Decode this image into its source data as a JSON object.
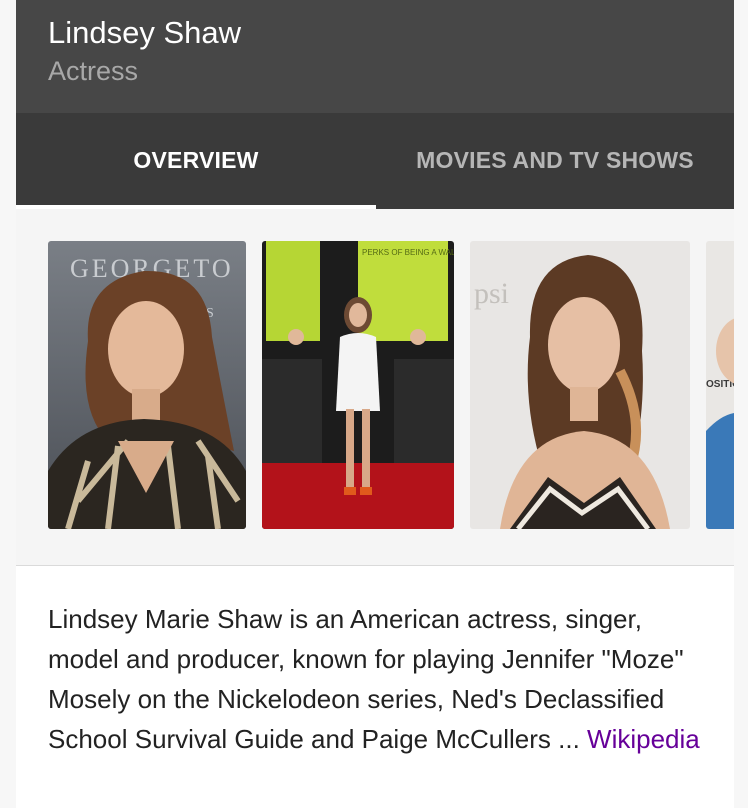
{
  "entity": {
    "name": "Lindsey Shaw",
    "type": "Actress"
  },
  "tabs": [
    {
      "label": "OVERVIEW",
      "active": true
    },
    {
      "label": "MOVIES AND TV SHOWS",
      "active": false
    }
  ],
  "images": [
    {
      "backdrop_text": "GEORGETO",
      "backdrop_sub": "S"
    },
    {
      "backdrop_text": "PERKS OF BEING A WALLFLOWER"
    },
    {
      "backdrop_text": "psi"
    },
    {
      "backdrop_text": "OSITION"
    }
  ],
  "description": {
    "text": "Lindsey Marie Shaw is an American actress, singer, model and producer, known for playing Jennifer \"Moze\" Mosely on the Nickelodeon series, Ned's Declassified School Survival Guide and Paige McCullers ... ",
    "source_link": "Wikipedia"
  },
  "colors": {
    "header_bg": "#474747",
    "tabs_bg": "#3a3a3a",
    "link": "#660099"
  }
}
